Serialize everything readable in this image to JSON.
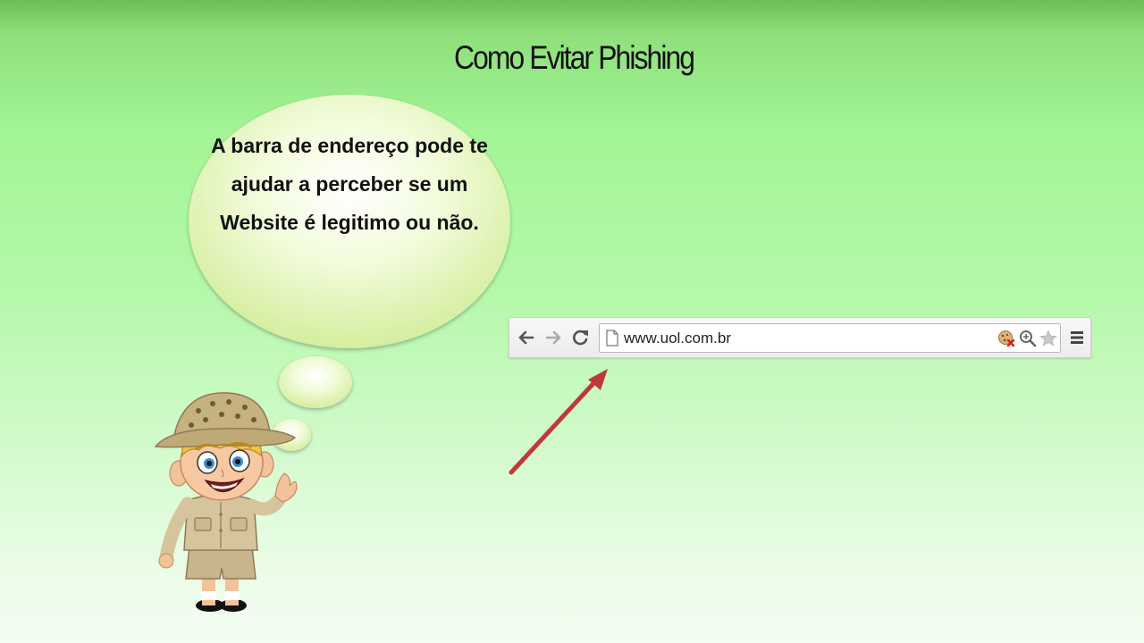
{
  "slide": {
    "title": "Como Evitar Phishing",
    "speech_text": "A barra de endereço pode te ajudar a perceber se um Website é legitimo ou não."
  },
  "browser": {
    "url": "www.uol.com.br",
    "icons": {
      "back": "back-arrow-icon",
      "forward": "forward-arrow-icon",
      "reload": "reload-icon",
      "page": "page-icon",
      "cookie_blocked": "cookie-blocked-icon",
      "zoom": "zoom-icon",
      "bookmark": "star-icon",
      "menu": "menu-icon"
    }
  },
  "colors": {
    "arrow": "#c0383a",
    "bubble_fill": "#f1fcd6",
    "bubble_edge": "#d6efa0"
  }
}
